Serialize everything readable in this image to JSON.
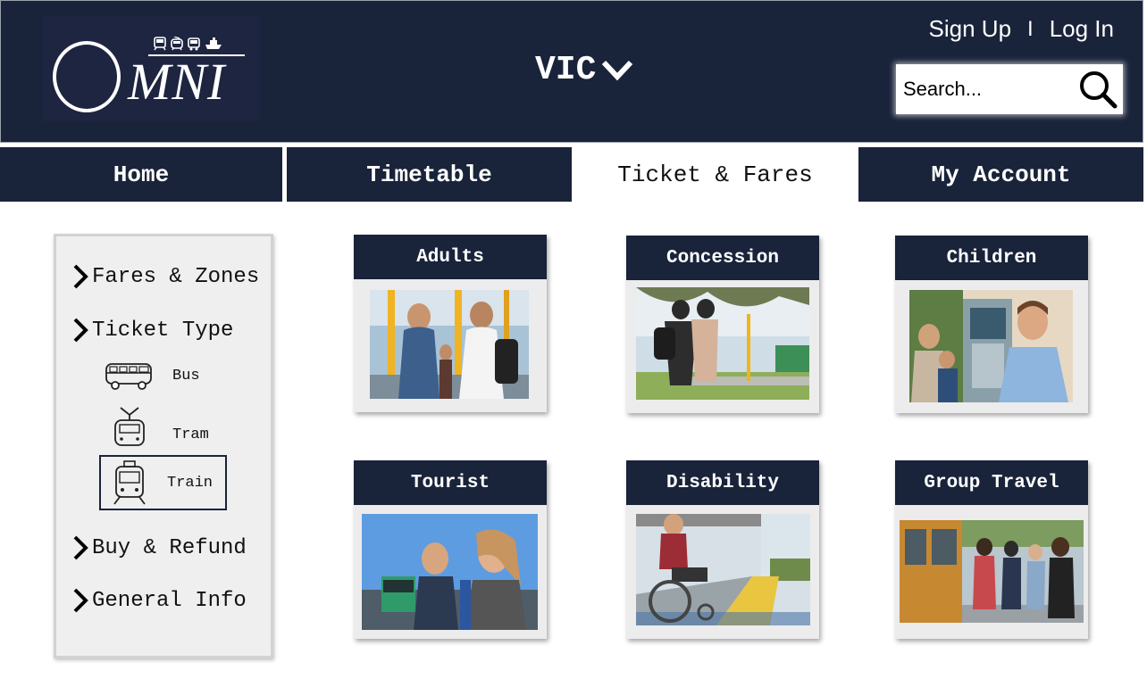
{
  "header": {
    "logo_text": "MNI",
    "state_selector": "VIC",
    "auth": {
      "sign_up": "Sign Up",
      "separator": "I",
      "log_in": "Log In"
    },
    "search": {
      "placeholder": "Search..."
    }
  },
  "nav": {
    "tabs": [
      {
        "label": "Home"
      },
      {
        "label": "Timetable"
      },
      {
        "label": "Ticket & Fares"
      },
      {
        "label": "My Account"
      }
    ],
    "active_tab": "Ticket & Fares"
  },
  "sidebar": {
    "items": [
      {
        "label": "Fares & Zones"
      },
      {
        "label": "Ticket Type"
      },
      {
        "label": "Buy & Refund"
      },
      {
        "label": "General Info"
      }
    ],
    "ticket_types": [
      {
        "label": "Bus",
        "icon": "bus-icon"
      },
      {
        "label": "Tram",
        "icon": "tram-icon"
      },
      {
        "label": "Train",
        "icon": "train-icon"
      }
    ],
    "selected_ticket_type": "Train"
  },
  "cards": [
    {
      "title": "Adults"
    },
    {
      "title": "Concession"
    },
    {
      "title": "Children"
    },
    {
      "title": "Tourist"
    },
    {
      "title": "Disability"
    },
    {
      "title": "Group Travel"
    }
  ],
  "colors": {
    "navy": "#19233a",
    "card_bg": "#ececec",
    "sidebar_bg": "#efefef"
  }
}
